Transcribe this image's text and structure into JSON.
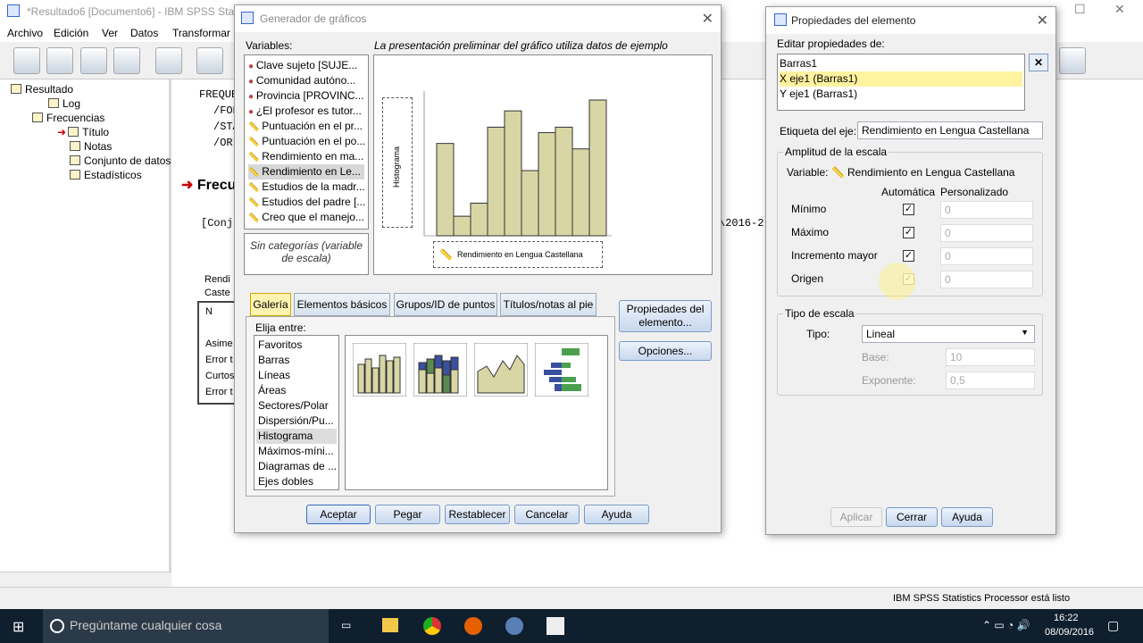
{
  "app": {
    "title": "*Resultado6 [Documento6] - IBM SPSS Statistics",
    "menu": [
      "Archivo",
      "Edición",
      "Ver",
      "Datos",
      "Transformar"
    ],
    "status": "IBM SPSS Statistics Processor está listo"
  },
  "nav": {
    "items": [
      "Resultado",
      "Log",
      "Frecuencias",
      "Título",
      "Notas",
      "Conjunto de datos",
      "Estadísticos"
    ]
  },
  "output": {
    "lines": [
      "FREQUE",
      "/FOR",
      "/STA",
      "/ORI"
    ],
    "heading": "Frecu",
    "conj": "[Conju",
    "path": "\\2016-2",
    "stat_labels": [
      "Rendi",
      "Caste",
      "N",
      "Asime",
      "Error t",
      "Curtos",
      "Error t"
    ]
  },
  "builder": {
    "title": "Generador de gráficos",
    "variables_label": "Variables:",
    "preview_label": "La presentación preliminar del gráfico utiliza datos de ejemplo",
    "variables": [
      "Clave sujeto [SUJE...",
      "Comunidad autóno...",
      "Provincia [PROVINC...",
      "¿El profesor es tutor...",
      "Puntuación en el pr...",
      "Puntuación en el po...",
      "Rendimiento en ma...",
      "Rendimiento en Le...",
      "Estudios de la madr...",
      "Estudios del padre [...",
      "Creo que el manejo..."
    ],
    "categories_note": "Sin categorías (variable de escala)",
    "y_axis_label": "Histograma",
    "x_axis_label": "Rendimiento en Lengua Castellana",
    "chart_data": {
      "type": "bar",
      "values": [
        8.5,
        1.8,
        3,
        10,
        11.5,
        6,
        9.5,
        10,
        8,
        12.5
      ]
    },
    "tabs": [
      "Galería",
      "Elementos básicos",
      "Grupos/ID de puntos",
      "Títulos/notas al pie"
    ],
    "choose_label": "Elija entre:",
    "gallery": [
      "Favoritos",
      "Barras",
      "Líneas",
      "Áreas",
      "Sectores/Polar",
      "Dispersión/Pu...",
      "Histograma",
      "Máximos-míni...",
      "Diagramas de ...",
      "Ejes dobles"
    ],
    "props_button": "Propiedades del elemento...",
    "options_button": "Opciones...",
    "buttons": [
      "Aceptar",
      "Pegar",
      "Restablecer",
      "Cancelar",
      "Ayuda"
    ]
  },
  "props": {
    "title": "Propiedades del elemento",
    "edit_label": "Editar propiedades de:",
    "elements": [
      "Barras1",
      "X eje1 (Barras1)",
      "Y eje1 (Barras1)"
    ],
    "axis_label": "Etiqueta del eje:",
    "axis_value": "Rendimiento en Lengua Castellana",
    "scale_range": "Amplitud de la escala",
    "variable_label": "Variable:",
    "variable_value": "Rendimiento en Lengua Castellana",
    "col_auto": "Automática",
    "col_custom": "Personalizado",
    "rows": [
      {
        "label": "Mínimo",
        "value": "0"
      },
      {
        "label": "Máximo",
        "value": "0"
      },
      {
        "label": "Incremento mayor",
        "value": "0"
      },
      {
        "label": "Origen",
        "value": "0"
      }
    ],
    "scale_type": "Tipo de escala",
    "type_label": "Tipo:",
    "type_value": "Lineal",
    "base_label": "Base:",
    "base_value": "10",
    "exp_label": "Exponente:",
    "exp_value": "0,5",
    "buttons": [
      "Aplicar",
      "Cerrar",
      "Ayuda"
    ]
  },
  "taskbar": {
    "search": "Pregúntame cualquier cosa",
    "time": "16:22",
    "date": "08/09/2016"
  }
}
